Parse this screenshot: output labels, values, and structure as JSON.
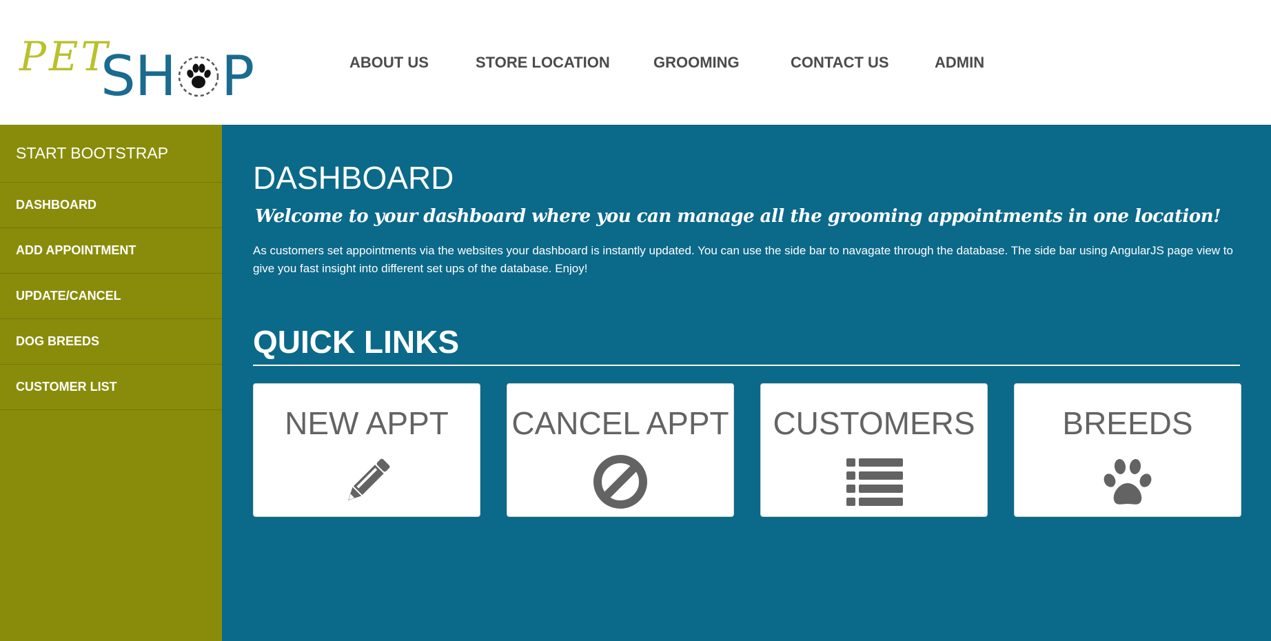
{
  "logo": {
    "pet": "PET",
    "shop_s": "S",
    "shop_h": "H",
    "shop_p": "P"
  },
  "nav": [
    {
      "label": "ABOUT US"
    },
    {
      "label": "STORE LOCATION"
    },
    {
      "label": "GROOMING"
    },
    {
      "label": "CONTACT US"
    },
    {
      "label": "ADMIN"
    }
  ],
  "sidebar": {
    "brand": "START BOOTSTRAP",
    "items": [
      {
        "label": "DASHBOARD"
      },
      {
        "label": "ADD APPOINTMENT"
      },
      {
        "label": "UPDATE/CANCEL"
      },
      {
        "label": "DOG BREEDS"
      },
      {
        "label": "CUSTOMER LIST"
      }
    ]
  },
  "main": {
    "title": "DASHBOARD",
    "welcome": "Welcome to your dashboard where you can manage all the grooming appointments in one location!",
    "description": "As customers set appointments via the websites your dashboard is instantly updated. You can use the side bar to navagate through the database. The side bar using AngularJS page view to give you fast insight into different set ups of the database. Enjoy!",
    "quick_links_title": "QUICK LINKS",
    "cards": [
      {
        "label": "NEW APPT",
        "icon": "pencil-icon"
      },
      {
        "label": "CANCEL APPT",
        "icon": "ban-icon"
      },
      {
        "label": "CUSTOMERS",
        "icon": "list-icon"
      },
      {
        "label": "BREEDS",
        "icon": "paw-icon"
      }
    ]
  },
  "colors": {
    "sidebar": "#898c0a",
    "main": "#0b6989",
    "logo_pet": "#b8c12c",
    "logo_shop": "#1a6b8f",
    "card_text": "#636363"
  }
}
